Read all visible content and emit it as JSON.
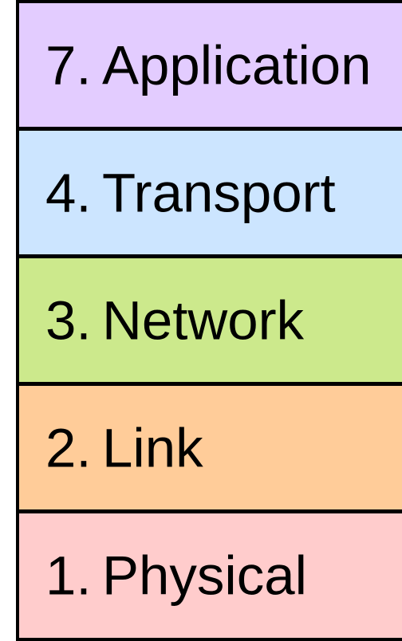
{
  "layers": [
    {
      "number": "7.",
      "name": "Application",
      "color": "#e3ccff"
    },
    {
      "number": "4.",
      "name": "Transport",
      "color": "#cce5ff"
    },
    {
      "number": "3.",
      "name": "Network",
      "color": "#cce98c"
    },
    {
      "number": "2.",
      "name": "Link",
      "color": "#ffcc99"
    },
    {
      "number": "1.",
      "name": "Physical",
      "color": "#ffcccc"
    }
  ]
}
